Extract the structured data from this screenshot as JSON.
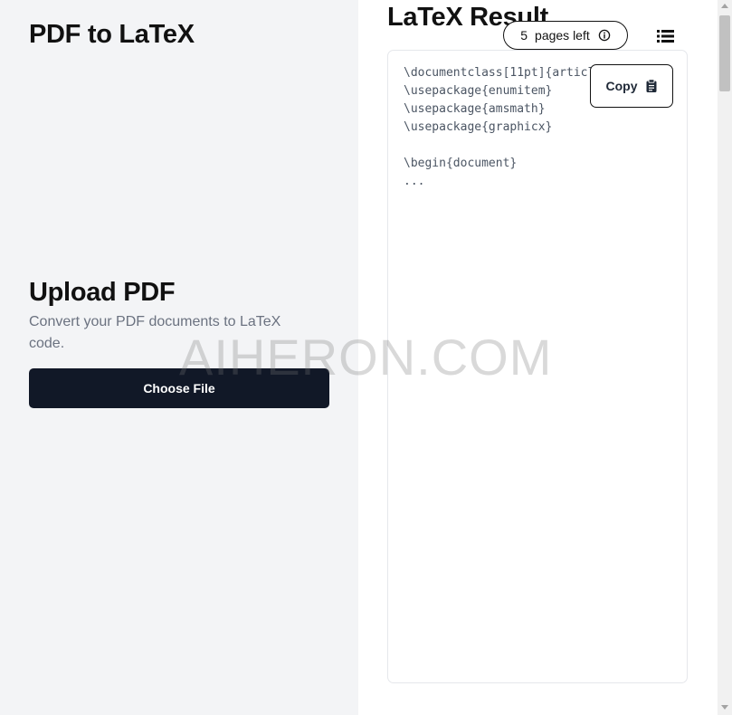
{
  "left": {
    "app_title": "PDF to LaTeX",
    "upload": {
      "heading": "Upload PDF",
      "description": "Convert your PDF documents to LaTeX code.",
      "choose_label": "Choose File"
    }
  },
  "right": {
    "title": "LaTeX Result",
    "pages_pill": {
      "count": "5",
      "label": "pages left",
      "icon": "info-circle-icon"
    },
    "menu_icon": "list-icon",
    "code": "\\documentclass[11pt]{article}\n\\usepackage{enumitem}\n\\usepackage{amsmath}\n\\usepackage{graphicx}\n\n\\begin{document}\n...",
    "copy_label": "Copy",
    "copy_icon": "clipboard-icon"
  },
  "watermark": "AIHERON.COM",
  "colors": {
    "left_bg": "#f3f4f6",
    "button_bg": "#111827",
    "muted_text": "#6b7280",
    "border": "#e5e7eb"
  }
}
